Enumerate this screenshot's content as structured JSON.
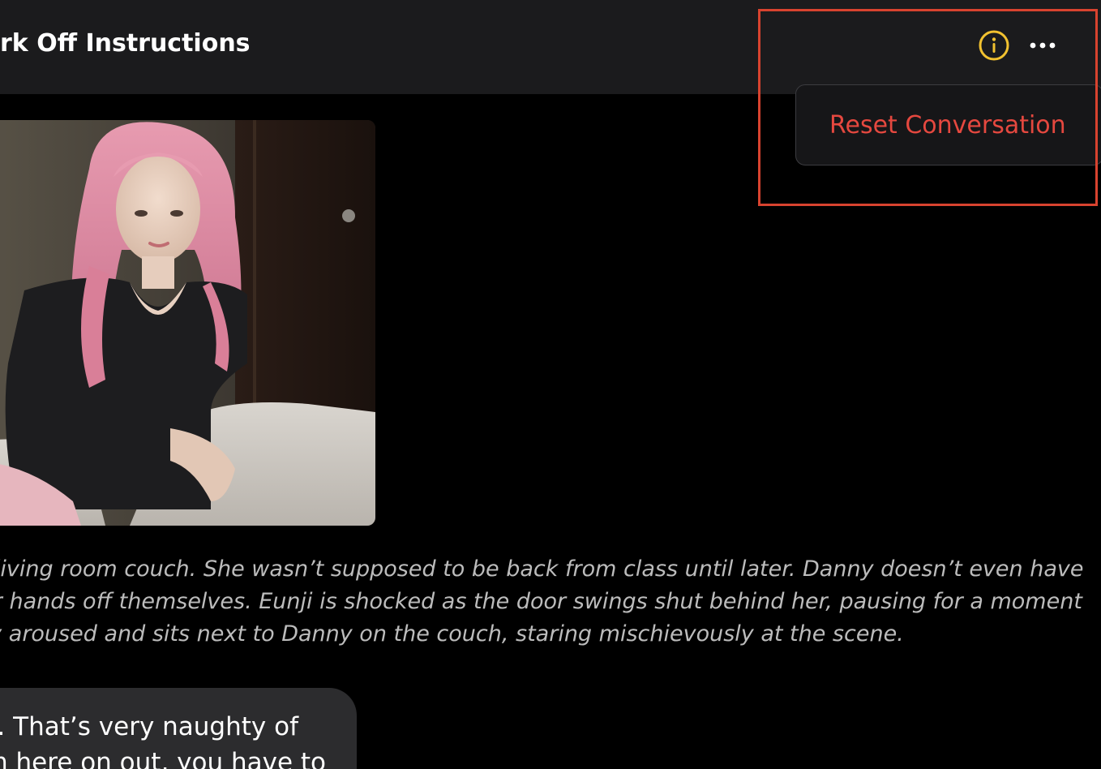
{
  "header": {
    "title": "rk Off Instructions"
  },
  "menu": {
    "items": [
      {
        "label": "Reset Conversation"
      }
    ]
  },
  "message": {
    "narration_lines": [
      "the living room couch. She wasn’t supposed to be back from class until later. Danny doesn’t even have",
      "their hands off themselves. Eunji is shocked as the door swings shut behind her, pausing for a moment",
      "sibly aroused and sits next to Danny on the couch, staring mischievously at the scene."
    ],
    "bubble_lines": [
      "n. That’s very naughty of",
      "m here on out, you have to"
    ]
  },
  "colors": {
    "header_bg": "#1b1b1d",
    "info_icon": "#f2c230",
    "menu_item_text": "#e5483f",
    "highlight_border": "#d8432f"
  },
  "icons": {
    "info": "info-circle-icon",
    "more": "more-horizontal-icon"
  }
}
